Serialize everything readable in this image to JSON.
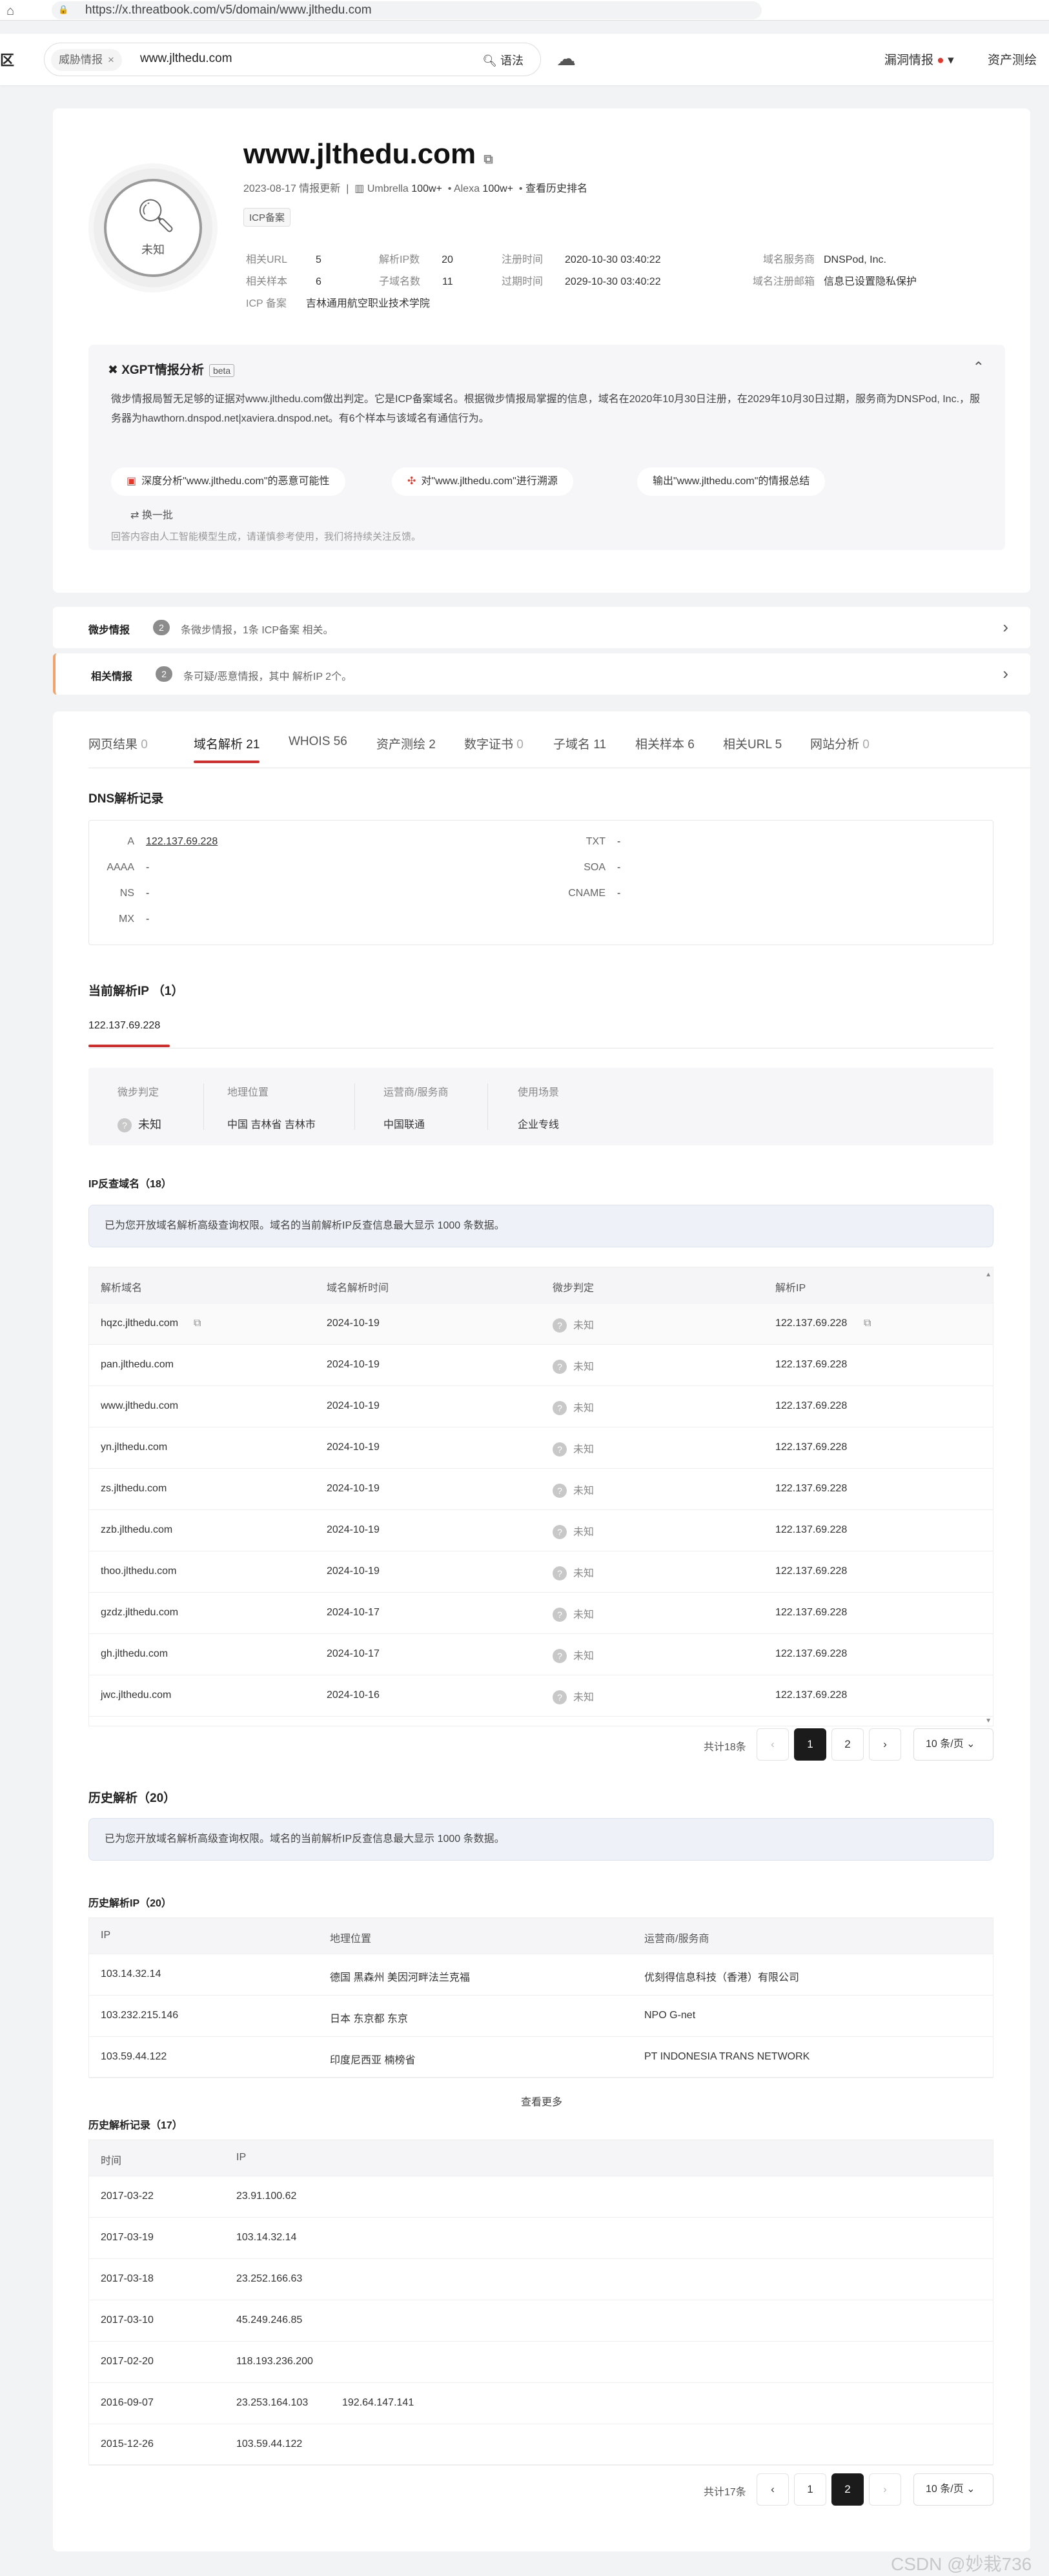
{
  "browser": {
    "url": "https://x.threatbook.com/v5/domain/www.jlthedu.com"
  },
  "topnav": {
    "logo": "区",
    "chip": "威胁情报",
    "query": "www.jlthedu.com",
    "syntax_label": "语法",
    "vuln_label": "漏洞情报",
    "asset_label": "资产测绘"
  },
  "domain": {
    "name": "www.jlthedu.com",
    "verdict": "未知",
    "updated": "2023-08-17 情报更新",
    "umbrella_label": "Umbrella",
    "umbrella_value": "100w+",
    "alexa_label": "Alexa",
    "alexa_value": "100w+",
    "history_rank": "查看历史排名",
    "icp_badge": "ICP备案",
    "fields": {
      "related_url_label": "相关URL",
      "related_url": "5",
      "related_sample_label": "相关样本",
      "related_sample": "6",
      "icp_label": "ICP 备案",
      "icp": "吉林通用航空职业技术学院",
      "resolve_ip_label": "解析IP数",
      "resolve_ip": "20",
      "subdomain_label": "子域名数",
      "subdomain": "11",
      "reg_time_label": "注册时间",
      "reg_time": "2020-10-30 03:40:22",
      "exp_time_label": "过期时间",
      "exp_time": "2029-10-30 03:40:22",
      "registrar_label": "域名服务商",
      "registrar": "DNSPod, Inc.",
      "reg_email_label": "域名注册邮箱",
      "reg_email": "信息已设置隐私保护"
    }
  },
  "xgpt": {
    "title": "XGPT情报分析",
    "beta": "beta",
    "text": "微步情报局暂无足够的证据对www.jlthedu.com做出判定。它是ICP备案域名。根据微步情报局掌握的信息，域名在2020年10月30日注册，在2029年10月30日过期，服务商为DNSPod, Inc.，服务器为hawthorn.dnspod.net|xaviera.dnspod.net。有6个样本与该域名有通信行为。",
    "pills": [
      "深度分析\"www.jlthedu.com\"的恶意可能性",
      "对\"www.jlthedu.com\"进行溯源",
      "输出\"www.jlthedu.com\"的情报总结"
    ],
    "swap": "换一批",
    "note": "回答内容由人工智能模型生成，请谨慎参考使用，我们将持续关注反馈。"
  },
  "intel_rows": [
    {
      "title": "微步情报",
      "count": "2",
      "desc": "条微步情报，1条 ICP备案 相关。"
    },
    {
      "title": "相关情报",
      "count": "2",
      "desc": "条可疑/恶意情报，其中 解析IP 2个。"
    }
  ],
  "tabs": [
    {
      "label": "网页结果",
      "count": "0"
    },
    {
      "label": "域名解析",
      "count": "21"
    },
    {
      "label": "WHOIS",
      "count": "56"
    },
    {
      "label": "资产测绘",
      "count": "2"
    },
    {
      "label": "数字证书",
      "count": "0"
    },
    {
      "label": "子域名",
      "count": "11"
    },
    {
      "label": "相关样本",
      "count": "6"
    },
    {
      "label": "相关URL",
      "count": "5"
    },
    {
      "label": "网站分析",
      "count": "0"
    }
  ],
  "dns": {
    "title": "DNS解析记录",
    "A": "122.137.69.228",
    "AAAA": "-",
    "NS": "-",
    "MX": "-",
    "TXT": "-",
    "SOA": "-",
    "CNAME": "-"
  },
  "current_ip": {
    "title": "当前解析IP （1）",
    "tab": "122.137.69.228",
    "headers": [
      "微步判定",
      "地理位置",
      "运营商/服务商",
      "使用场景"
    ],
    "values": [
      "未知",
      "中国 吉林省 吉林市",
      "中国联通",
      "企业专线"
    ]
  },
  "reverse": {
    "title": "IP反查域名（18）",
    "notice": "已为您开放域名解析高级查询权限。域名的当前解析IP反查信息最大显示 1000 条数据。",
    "headers": [
      "解析域名",
      "域名解析时间",
      "微步判定",
      "解析IP"
    ],
    "rows": [
      [
        "hqzc.jlthedu.com",
        "2024-10-19",
        "未知",
        "122.137.69.228"
      ],
      [
        "pan.jlthedu.com",
        "2024-10-19",
        "未知",
        "122.137.69.228"
      ],
      [
        "www.jlthedu.com",
        "2024-10-19",
        "未知",
        "122.137.69.228"
      ],
      [
        "yn.jlthedu.com",
        "2024-10-19",
        "未知",
        "122.137.69.228"
      ],
      [
        "zs.jlthedu.com",
        "2024-10-19",
        "未知",
        "122.137.69.228"
      ],
      [
        "zzb.jlthedu.com",
        "2024-10-19",
        "未知",
        "122.137.69.228"
      ],
      [
        "thoo.jlthedu.com",
        "2024-10-19",
        "未知",
        "122.137.69.228"
      ],
      [
        "gzdz.jlthedu.com",
        "2024-10-17",
        "未知",
        "122.137.69.228"
      ],
      [
        "gh.jlthedu.com",
        "2024-10-17",
        "未知",
        "122.137.69.228"
      ],
      [
        "jwc.jlthedu.com",
        "2024-10-16",
        "未知",
        "122.137.69.228"
      ]
    ],
    "total": "共计18条",
    "pages": [
      "1",
      "2"
    ],
    "page_size": "10 条/页"
  },
  "history": {
    "title": "历史解析（20）",
    "notice": "已为您开放域名解析高级查询权限。域名的当前解析IP反查信息最大显示 1000 条数据。",
    "ip_title": "历史解析IP（20）",
    "ip_headers": [
      "IP",
      "地理位置",
      "运营商/服务商"
    ],
    "ip_rows": [
      [
        "103.14.32.14",
        "德国 黑森州 美因河畔法兰克福",
        "优刻得信息科技（香港）有限公司"
      ],
      [
        "103.232.215.146",
        "日本 东京都 东京",
        "NPO G-net"
      ],
      [
        "103.59.44.122",
        "印度尼西亚 楠榜省",
        "PT INDONESIA TRANS NETWORK"
      ]
    ],
    "more": "查看更多",
    "rec_title": "历史解析记录（17）",
    "rec_headers": [
      "时间",
      "IP"
    ],
    "rec_rows": [
      [
        "2017-03-22",
        "23.91.100.62",
        ""
      ],
      [
        "2017-03-19",
        "103.14.32.14",
        ""
      ],
      [
        "2017-03-18",
        "23.252.166.63",
        ""
      ],
      [
        "2017-03-10",
        "45.249.246.85",
        ""
      ],
      [
        "2017-02-20",
        "118.193.236.200",
        ""
      ],
      [
        "2016-09-07",
        "23.253.164.103",
        "192.64.147.141"
      ],
      [
        "2015-12-26",
        "103.59.44.122",
        ""
      ]
    ],
    "total": "共计17条",
    "pages": [
      "1",
      "2"
    ],
    "page_size": "10 条/页"
  },
  "watermark": "CSDN @妙栽736"
}
